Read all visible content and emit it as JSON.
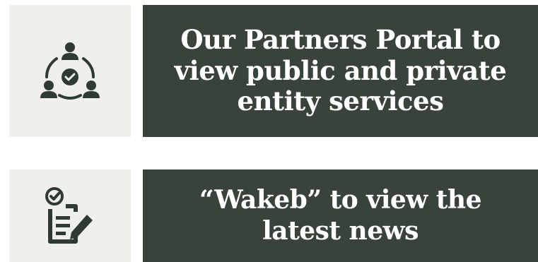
{
  "colors": {
    "icon_bg": "#efefeb",
    "card_bg": "#39433c",
    "icon_fg": "#2f3a33",
    "text": "#ffffff"
  },
  "cards": [
    {
      "icon": "partners-network-icon",
      "label": "Our Partners Portal to view public and private entity services"
    },
    {
      "icon": "document-edit-check-icon",
      "label": "“Wakeb” to view the latest news"
    }
  ]
}
